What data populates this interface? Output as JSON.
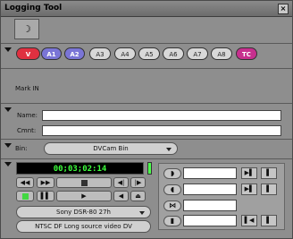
{
  "window": {
    "title": "Logging Tool",
    "close_label": "×"
  },
  "mode_button": {
    "icon": "moon-icon",
    "label": "☽"
  },
  "tracks": [
    {
      "label": "V",
      "style": "red"
    },
    {
      "label": "A1",
      "style": "blue"
    },
    {
      "label": "A2",
      "style": "blue"
    },
    {
      "label": "A3",
      "style": "grey"
    },
    {
      "label": "A4",
      "style": "grey"
    },
    {
      "label": "A5",
      "style": "grey"
    },
    {
      "label": "A6",
      "style": "grey"
    },
    {
      "label": "A7",
      "style": "grey"
    },
    {
      "label": "A8",
      "style": "grey"
    },
    {
      "label": "TC",
      "style": "pink"
    }
  ],
  "status": {
    "text": "Mark IN"
  },
  "clip": {
    "name_label": "Name:",
    "name_value": "",
    "cmnt_label": "Cmnt:",
    "cmnt_value": ""
  },
  "bin": {
    "label": "Bin:",
    "value": "DVCam Bin"
  },
  "transport": {
    "timecode": "00;03;02:14",
    "deck": "Sony DSR-80 27h",
    "format": "NTSC DF Long source video DV"
  },
  "marks": {
    "mark_in_value": "",
    "mark_out_value": "",
    "duration_value": "",
    "clip_value": ""
  },
  "colors": {
    "track_red": "#e03040",
    "track_blue": "#7a75d6",
    "track_pink": "#c72f8e",
    "timecode_green": "#3cff3c",
    "record_green": "#41d841"
  }
}
